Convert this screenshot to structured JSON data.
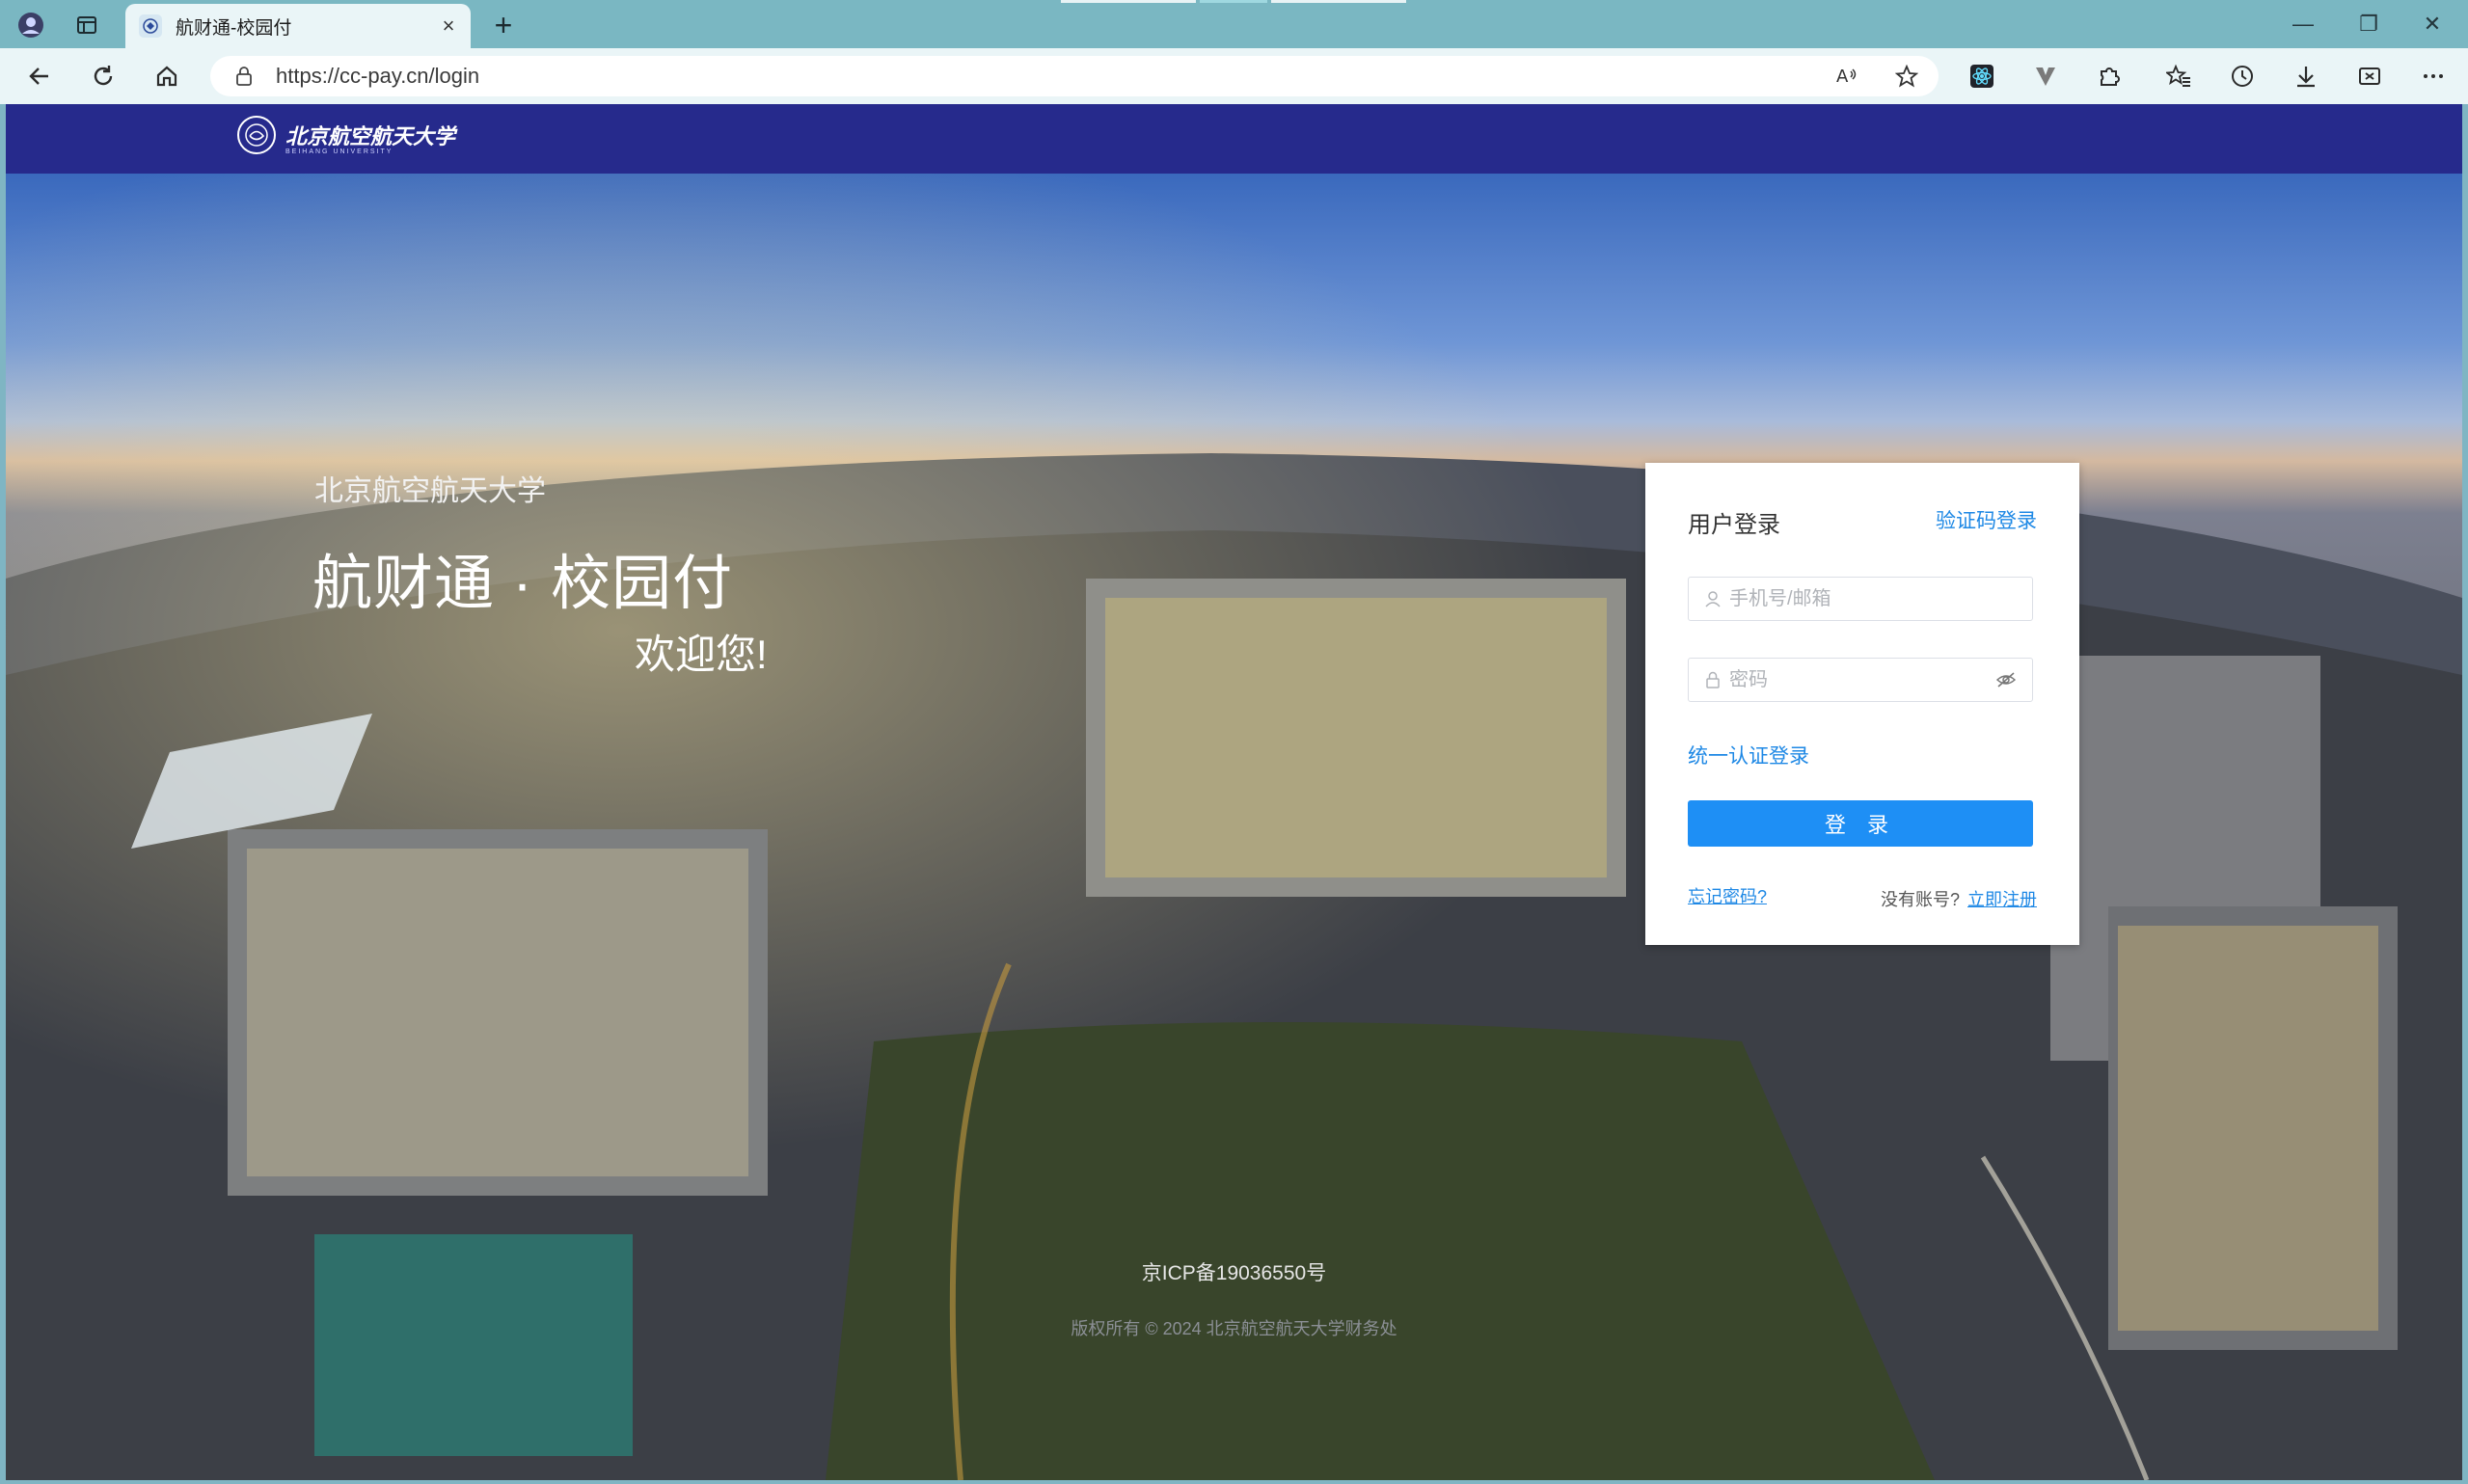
{
  "browser": {
    "tab_title": "航财通-校园付",
    "url": "https://cc-pay.cn/login",
    "new_tab_symbol": "+",
    "tab_close_symbol": "×",
    "window_controls": {
      "minimize": "—",
      "restore": "❐",
      "close": "✕"
    }
  },
  "header": {
    "university_name": "北京航空航天大学",
    "university_name_en": "BEIHANG UNIVERSITY"
  },
  "hero": {
    "university": "北京航空航天大学",
    "title": "航财通 · 校园付",
    "welcome": "欢迎您!"
  },
  "login": {
    "title": "用户登录",
    "switch_mode": "验证码登录",
    "account_placeholder": "手机号/邮箱",
    "password_placeholder": "密码",
    "sso_link": "统一认证登录",
    "submit_label": "登 录",
    "forgot_password": "忘记密码?",
    "no_account_text": "没有账号?",
    "register_link": "立即注册"
  },
  "footer": {
    "icp": "京ICP备19036550号",
    "copyright": "版权所有 © 2024 北京航空航天大学财务处"
  },
  "colors": {
    "header_bg": "#262a8c",
    "accent": "#1e88e5",
    "button_bg": "#1e8ff5",
    "chrome_tabstrip": "#7ab7c2",
    "chrome_toolbar": "#eaf5f7"
  },
  "icons": [
    "profile-icon",
    "tab-actions-icon",
    "back-icon",
    "reload-icon",
    "home-icon",
    "lock-icon",
    "read-aloud-icon",
    "favorite-star-icon",
    "extension-react-icon",
    "extension-v-icon",
    "extensions-puzzle-icon",
    "favorites-icon",
    "history-icon",
    "download-icon",
    "screenshot-icon",
    "more-icon",
    "user-icon",
    "password-lock-icon",
    "eye-hidden-icon"
  ]
}
